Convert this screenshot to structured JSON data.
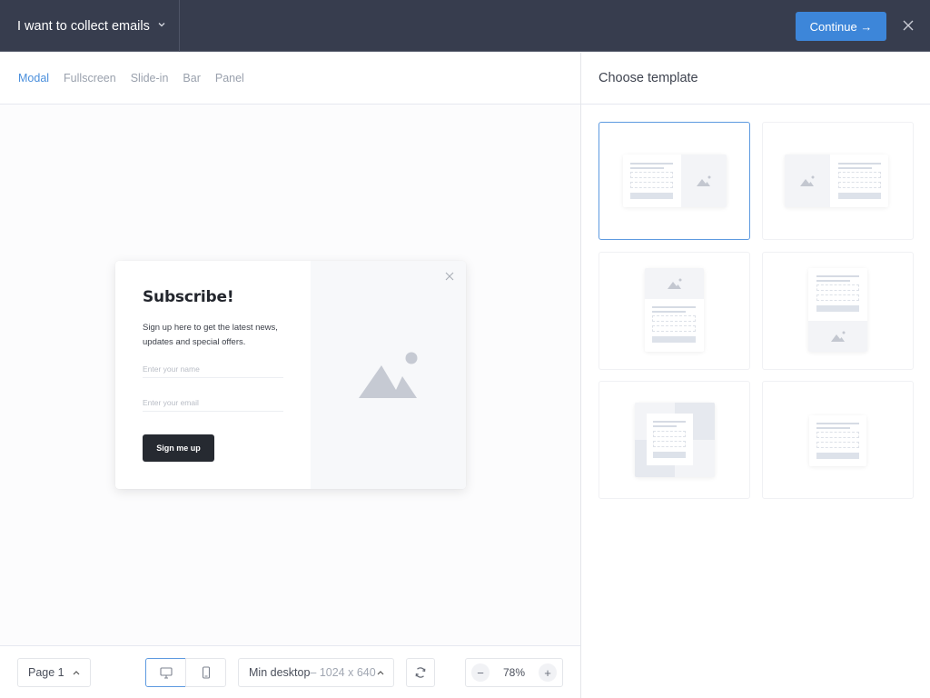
{
  "topbar": {
    "goal_label": "I want to collect emails",
    "goal_chevron": "⌄",
    "continue_label": "Continue →",
    "close_icon": "close-icon"
  },
  "tabs": [
    {
      "label": "Modal",
      "active": true
    },
    {
      "label": "Fullscreen",
      "active": false
    },
    {
      "label": "Slide-in",
      "active": false
    },
    {
      "label": "Bar",
      "active": false
    },
    {
      "label": "Panel",
      "active": false
    }
  ],
  "popup": {
    "title": "Subscribe!",
    "description": "Sign up here to get the latest news, updates and special offers.",
    "name_placeholder": "Enter your name",
    "email_placeholder": "Enter your email",
    "button_label": "Sign me up",
    "image_icon": "image-placeholder-icon"
  },
  "bottombar": {
    "page_label": "Page 1",
    "caret": "^",
    "device_selected": "desktop",
    "size_label": "Min desktop",
    "size_dims": "– 1024 x 640",
    "zoom_value": "78%",
    "zoom_minus": "−",
    "zoom_plus": "+"
  },
  "right": {
    "header": "Choose template",
    "templates": [
      {
        "layout": "form-left-image-right",
        "selected": true
      },
      {
        "layout": "image-left-form-right",
        "selected": false
      },
      {
        "layout": "image-top-form-bottom",
        "selected": false
      },
      {
        "layout": "form-top-image-bottom",
        "selected": false
      },
      {
        "layout": "form-over-background",
        "selected": false
      },
      {
        "layout": "form-only",
        "selected": false
      }
    ]
  },
  "colors": {
    "topbar_bg": "#373d4e",
    "accent": "#3d86d9",
    "active_tab": "#4a8fdc",
    "popup_button": "#262a31"
  }
}
